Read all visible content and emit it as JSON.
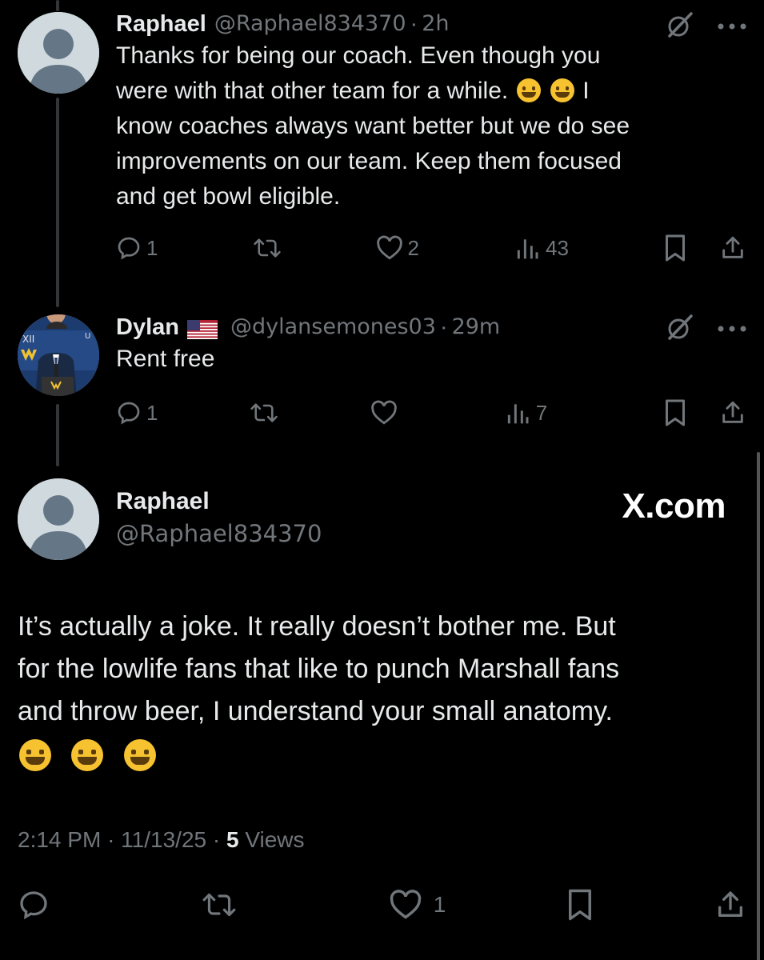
{
  "reply1": {
    "name": "Raphael",
    "handle": "@Raphael834370",
    "time": "2h",
    "text_lines": [
      "Thanks for being our coach. Even though you",
      "were with that other team for a while.",
      "know coaches always want better but we do see",
      "improvements on our team. Keep them focused",
      "and get bowl eligible."
    ],
    "line2_tail": "I",
    "replies": "1",
    "likes": "2",
    "views": "43"
  },
  "reply2": {
    "name": "Dylan",
    "handle": "@dylansemones03",
    "time": "29m",
    "text": "Rent free",
    "replies": "1",
    "views": "7"
  },
  "main": {
    "name": "Raphael",
    "handle": "@Raphael834370",
    "watermark": "X.com",
    "text_lines": [
      "It’s actually a joke. It really doesn’t bother me. But",
      "for the lowlife fans that like to punch Marshall fans",
      "and throw beer, I understand your small anatomy."
    ],
    "time": "2:14 PM",
    "date": "11/13/25",
    "views_count": "5",
    "views_label": "Views",
    "likes": "1"
  },
  "icons": {
    "separator": "·",
    "grok": "grok-slash-icon",
    "more": "more-dots-icon",
    "reply": "reply-bubble-icon",
    "retweet": "retweet-icon",
    "like": "heart-icon",
    "views": "views-bars-icon",
    "bookmark": "bookmark-icon",
    "share": "share-icon"
  },
  "colors": {
    "background": "#000000",
    "text": "#e7e9ea",
    "muted": "#71767b",
    "thread_line": "#333639"
  }
}
